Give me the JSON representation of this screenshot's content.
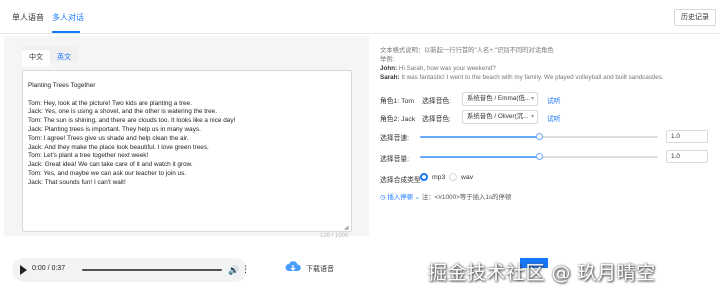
{
  "tabs": [
    {
      "label": "单人语音",
      "active": false
    },
    {
      "label": "多人对话",
      "active": true
    }
  ],
  "history_button": "历史记录",
  "lang_tabs": [
    {
      "label": "中文",
      "active": true
    },
    {
      "label": "英文",
      "active": false
    }
  ],
  "text_content": "Planting Trees Together\n\nTom: Hey, look at the picture! Two kids are planting a tree.\nJack: Yes, one is using a shovel, and the other is watering the tree.\nTom: The sun is shining, and there are clouds too. It looks like a nice day!\nJack: Planting trees is important. They help us in many ways.\nTom: I agree! Trees give us shade and help clean the air.\nJack: And they make the place look beautiful. I love green trees.\nTom: Let's plant a tree together next week!\nJack: Great idea! We can take care of it and watch it grow.\nTom: Yes, and maybe we can ask our teacher to join us.\nJack: That sounds fun! I can't wait!",
  "char_counter": "120 / 1000",
  "audio": {
    "time": "0:00 / 0:37"
  },
  "download_label": "下载语音",
  "tips": {
    "line1": "文本格式说明：以新起一行行首的\"人名+:\"识别不同的对话角色",
    "line2": "举例:",
    "ex1_name": "John:",
    "ex1_text": " Hi Sarah, how was your weekend?",
    "ex2_name": "Sarah:",
    "ex2_text": " It was fantastic! I went to the beach with my family. We played volleyball and built sandcastles."
  },
  "roles": [
    {
      "role_label": "角色1: Tom",
      "voice_label": "选择音色:",
      "voice_value": "系统音色 / Emma(低...",
      "link": "试听"
    },
    {
      "role_label": "角色2: Jack",
      "voice_label": "选择音色:",
      "voice_value": "系统音色 / Oliver(沉...",
      "link": "试听"
    }
  ],
  "speed": {
    "label": "选择音速:",
    "value": "1.0",
    "fraction": 0.5
  },
  "volume": {
    "label": "选择音量:",
    "value": "1.0",
    "fraction": 0.5
  },
  "format": {
    "label": "选择合成类型:",
    "options": [
      {
        "label": "mp3",
        "checked": true
      },
      {
        "label": "wav",
        "checked": false
      }
    ]
  },
  "pause": {
    "button": "插入停顿",
    "caret": "⌄",
    "note": "注：<#1000>等于插入1s的停顿"
  },
  "watermark": "掘金技术社区 @ 玖月晴空"
}
